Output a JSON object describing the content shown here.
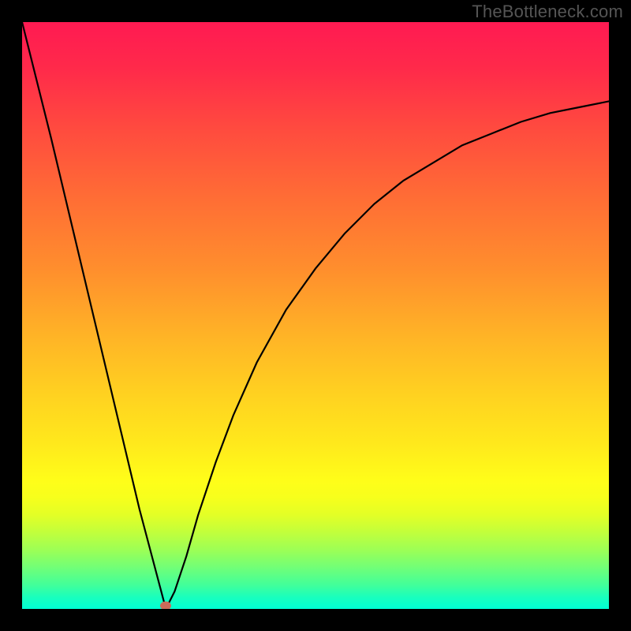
{
  "watermark": "TheBottleneck.com",
  "chart_data": {
    "type": "line",
    "title": "",
    "xlabel": "",
    "ylabel": "",
    "xlim": [
      0,
      1
    ],
    "ylim": [
      0,
      1
    ],
    "series": [
      {
        "name": "bottleneck-curve",
        "x": [
          0.0,
          0.05,
          0.1,
          0.15,
          0.2,
          0.245,
          0.26,
          0.28,
          0.3,
          0.33,
          0.36,
          0.4,
          0.45,
          0.5,
          0.55,
          0.6,
          0.65,
          0.7,
          0.75,
          0.8,
          0.85,
          0.9,
          0.95,
          1.0
        ],
        "values": [
          1.0,
          0.8,
          0.59,
          0.38,
          0.17,
          0.0,
          0.03,
          0.09,
          0.16,
          0.25,
          0.33,
          0.42,
          0.51,
          0.58,
          0.64,
          0.69,
          0.73,
          0.76,
          0.79,
          0.81,
          0.83,
          0.845,
          0.855,
          0.865
        ]
      }
    ],
    "minimum_marker": {
      "x": 0.245,
      "y": 0.0
    },
    "colors": {
      "top": "#ff1a52",
      "bottom": "#00ffd4",
      "curve": "#000000",
      "marker": "#cc6b5a"
    }
  }
}
